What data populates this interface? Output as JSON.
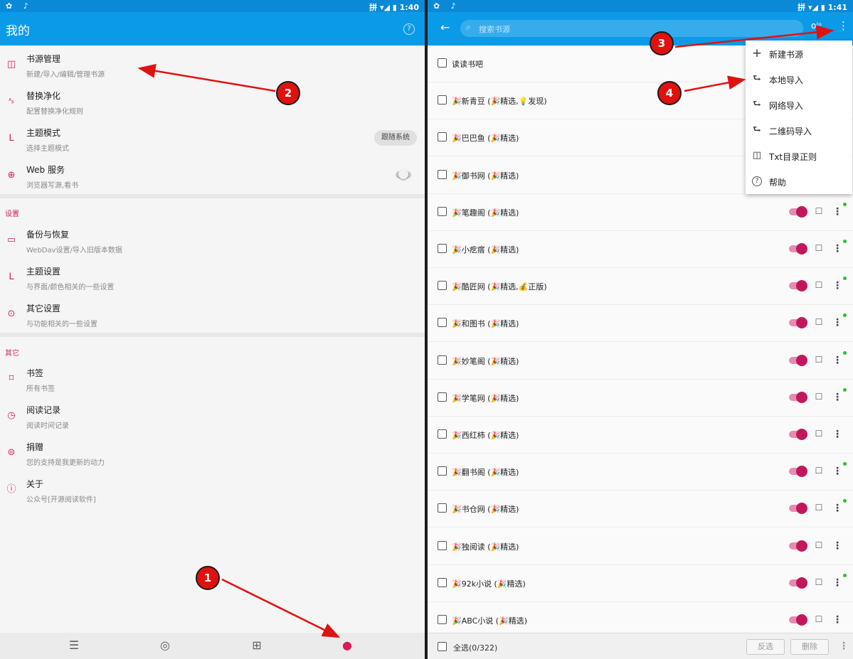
{
  "left": {
    "status": {
      "left_icons": "✿ ♪",
      "right": "拼 ▾◢ ▮ 1:40"
    },
    "title": "我的",
    "help_icon": "?",
    "items": [
      {
        "icon": "book-open-icon",
        "glyph": "◫",
        "title": "书源管理",
        "subtitle": "新建/导入/编辑/管理书源"
      },
      {
        "icon": "replace-icon",
        "glyph": "ᴬᵦ",
        "title": "替换净化",
        "subtitle": "配置替换净化规则"
      },
      {
        "icon": "tshirt-icon",
        "glyph": "ᒪ",
        "title": "主题模式",
        "subtitle": "选择主题模式"
      },
      {
        "icon": "globe-icon",
        "glyph": "⊕",
        "title": "Web 服务",
        "subtitle": "浏览器写源,看书"
      }
    ],
    "theme_chip": "跟随系统",
    "section_settings": "设置",
    "settings_items": [
      {
        "icon": "folder-icon",
        "glyph": "▭",
        "title": "备份与恢复",
        "subtitle": "WebDav设置/导入旧版本数据"
      },
      {
        "icon": "tshirt-icon",
        "glyph": "ᒪ",
        "title": "主题设置",
        "subtitle": "与界面/颜色相关的一些设置"
      },
      {
        "icon": "gear-icon",
        "glyph": "⊙",
        "title": "其它设置",
        "subtitle": "与功能相关的一些设置"
      }
    ],
    "section_other": "其它",
    "other_items": [
      {
        "icon": "bookmark-icon",
        "glyph": "⌑",
        "title": "书签",
        "subtitle": "所有书签"
      },
      {
        "icon": "clock-icon",
        "glyph": "◷",
        "title": "阅读记录",
        "subtitle": "阅读时间记录"
      },
      {
        "icon": "donate-icon",
        "glyph": "⊜",
        "title": "捐赠",
        "subtitle": "您的支持是我更新的动力"
      },
      {
        "icon": "info-icon",
        "glyph": "ⓘ",
        "title": "关于",
        "subtitle": "公众号[开源阅读软件]"
      }
    ],
    "nav": [
      {
        "icon": "bookshelf-icon",
        "glyph": "☰"
      },
      {
        "icon": "compass-icon",
        "glyph": "◎"
      },
      {
        "icon": "rss-icon",
        "glyph": "⊞"
      },
      {
        "icon": "person-icon",
        "glyph": "●"
      }
    ]
  },
  "right": {
    "status": {
      "left_icons": "✿ ♪",
      "right": "拼 ▾◢ ▮ 1:41"
    },
    "back_icon": "←",
    "search_icon": "⌕",
    "search_placeholder": "搜索书源",
    "group_icon": "o⁽ᵒ",
    "overflow_icon": "⋮",
    "sources": [
      {
        "name": "读读书吧",
        "controls": false,
        "dot": false
      },
      {
        "name": "🎉新青豆 (🎉精选,💡发现)",
        "controls": false,
        "dot": false
      },
      {
        "name": "🎉巴巴鱼 (🎉精选)",
        "controls": false,
        "dot": false
      },
      {
        "name": "🎉御书网 (🎉精选)",
        "controls": false,
        "dot": false
      },
      {
        "name": "🎉笔趣阁 (🎉精选)",
        "controls": true,
        "dot": true
      },
      {
        "name": "🎉小疙瘩 (🎉精选)",
        "controls": true,
        "dot": true
      },
      {
        "name": "🎉酷匠网 (🎉精选,💰正版)",
        "controls": true,
        "dot": true
      },
      {
        "name": "🎉和图书 (🎉精选)",
        "controls": true,
        "dot": true
      },
      {
        "name": "🎉妙笔阁 (🎉精选)",
        "controls": true,
        "dot": true
      },
      {
        "name": "🎉学笔网 (🎉精选)",
        "controls": true,
        "dot": true
      },
      {
        "name": "🎉西红柿 (🎉精选)",
        "controls": true,
        "dot": false
      },
      {
        "name": "🎉翻书阁 (🎉精选)",
        "controls": true,
        "dot": true
      },
      {
        "name": "🎉书仓网 (🎉精选)",
        "controls": true,
        "dot": true
      },
      {
        "name": "🎉独阅读 (🎉精选)",
        "controls": true,
        "dot": false
      },
      {
        "name": "🎉92k小说 (🎉精选)",
        "controls": true,
        "dot": true
      },
      {
        "name": "🎉ABC小说 (🎉精选)",
        "controls": true,
        "dot": false
      }
    ],
    "menu": [
      {
        "icon": "plus-icon",
        "glyph": "+",
        "label": "新建书源"
      },
      {
        "icon": "import-icon",
        "glyph": "⮑",
        "label": "本地导入"
      },
      {
        "icon": "import-icon",
        "glyph": "⮑",
        "label": "网络导入"
      },
      {
        "icon": "import-icon",
        "glyph": "⮑",
        "label": "二维码导入"
      },
      {
        "icon": "book-open-icon",
        "glyph": "◫",
        "label": "Txt目录正则"
      },
      {
        "icon": "help-icon",
        "glyph": "?",
        "label": "帮助"
      }
    ],
    "edit_glyph": "☐",
    "more_glyph": "⋮",
    "footer": {
      "select_all": "全选(0/322)",
      "invert": "反选",
      "delete": "删除",
      "more": "⋮"
    }
  },
  "annotations": [
    "1",
    "2",
    "3",
    "4"
  ],
  "colors": {
    "appbar": "#0b9ae8",
    "statusbar": "#0a8ad6",
    "accent": "#d81b60",
    "annotation": "#e0120f"
  }
}
